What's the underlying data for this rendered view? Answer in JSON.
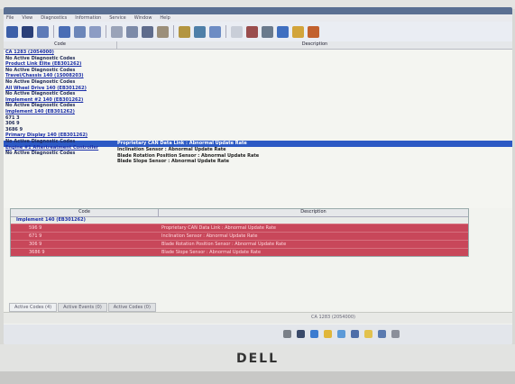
{
  "menu": {
    "items": [
      "File",
      "View",
      "Diagnostics",
      "Information",
      "Service",
      "Window",
      "Help"
    ]
  },
  "toolbar": {
    "icons": [
      "new-icon",
      "grid-icon",
      "open-icon",
      "save-icon",
      "print-icon",
      "cut-icon",
      "copy-icon",
      "paste-icon",
      "undo-icon",
      "link-icon",
      "settings-icon",
      "network-icon",
      "refresh-icon",
      "document-icon",
      "wrench-icon",
      "home-icon",
      "download-icon",
      "folder-icon",
      "chart-icon"
    ]
  },
  "top_table": {
    "headers": {
      "code": "Code",
      "description": "Description"
    },
    "code_tree": [
      {
        "text": "CA 1283 (2054000)",
        "kind": "node"
      },
      {
        "text": "No Active Diagnostic Codes",
        "kind": "noact"
      },
      {
        "text": "Product Link Elite (EB301262)",
        "kind": "node"
      },
      {
        "text": "No Active Diagnostic Codes",
        "kind": "noact"
      },
      {
        "text": "Travel/Chassis 140 (1S008203)",
        "kind": "node"
      },
      {
        "text": "No Active Diagnostic Codes",
        "kind": "noact"
      },
      {
        "text": "All Wheel Drive 140 (EB301262)",
        "kind": "node"
      },
      {
        "text": "No Active Diagnostic Codes",
        "kind": "noact"
      },
      {
        "text": "Implement #2 140 (EB301262)",
        "kind": "node"
      },
      {
        "text": "No Active Diagnostic Codes",
        "kind": "noact"
      },
      {
        "text": "Implement 140 (EB301262)",
        "kind": "node"
      },
      {
        "text": "",
        "kind": "selected"
      },
      {
        "text": "671 3",
        "kind": "dtc"
      },
      {
        "text": "306 9",
        "kind": "dtc"
      },
      {
        "text": "3686 9",
        "kind": "dtc"
      },
      {
        "text": "Primary Display 140 (EB301262)",
        "kind": "node"
      },
      {
        "text": "No Active Diagnostic Codes",
        "kind": "noact"
      },
      {
        "text": "Engine #1 Aftertreatment Controller",
        "kind": "node"
      },
      {
        "text": "No Active Diagnostic Codes",
        "kind": "noact"
      }
    ],
    "descriptions": [
      "Proprietary CAN Data Link : Abnormal Update Rate",
      "Inclination Sensor : Abnormal Update Rate",
      "Blade Rotation Position Sensor : Abnormal Update Rate",
      "Blade Slope Sensor : Abnormal Update Rate"
    ]
  },
  "bottom_table": {
    "headers": {
      "code": "Code",
      "description": "Description"
    },
    "node": "Implement 140 (EB301262)",
    "rows": [
      {
        "code": "596 9",
        "description": "Proprietary CAN Data Link : Abnormal Update Rate"
      },
      {
        "code": "671 9",
        "description": "Inclination Sensor : Abnormal Update Rate"
      },
      {
        "code": "306 9",
        "description": "Blade Rotation Position Sensor : Abnormal Update Rate"
      },
      {
        "code": "3686 9",
        "description": "Blade Slope Sensor : Abnormal Update Rate"
      }
    ],
    "row_color": "#c8475a"
  },
  "tabs": [
    "Active Codes (4)",
    "Active Events (0)",
    "Active Codes (0)"
  ],
  "status": {
    "text": "CA 1283 (2054000)"
  },
  "bezel": {
    "brand": "DELL"
  },
  "colors": {
    "selection": "#2c59c4",
    "link": "#1b2fa8",
    "fault_row": "#c8475a"
  }
}
